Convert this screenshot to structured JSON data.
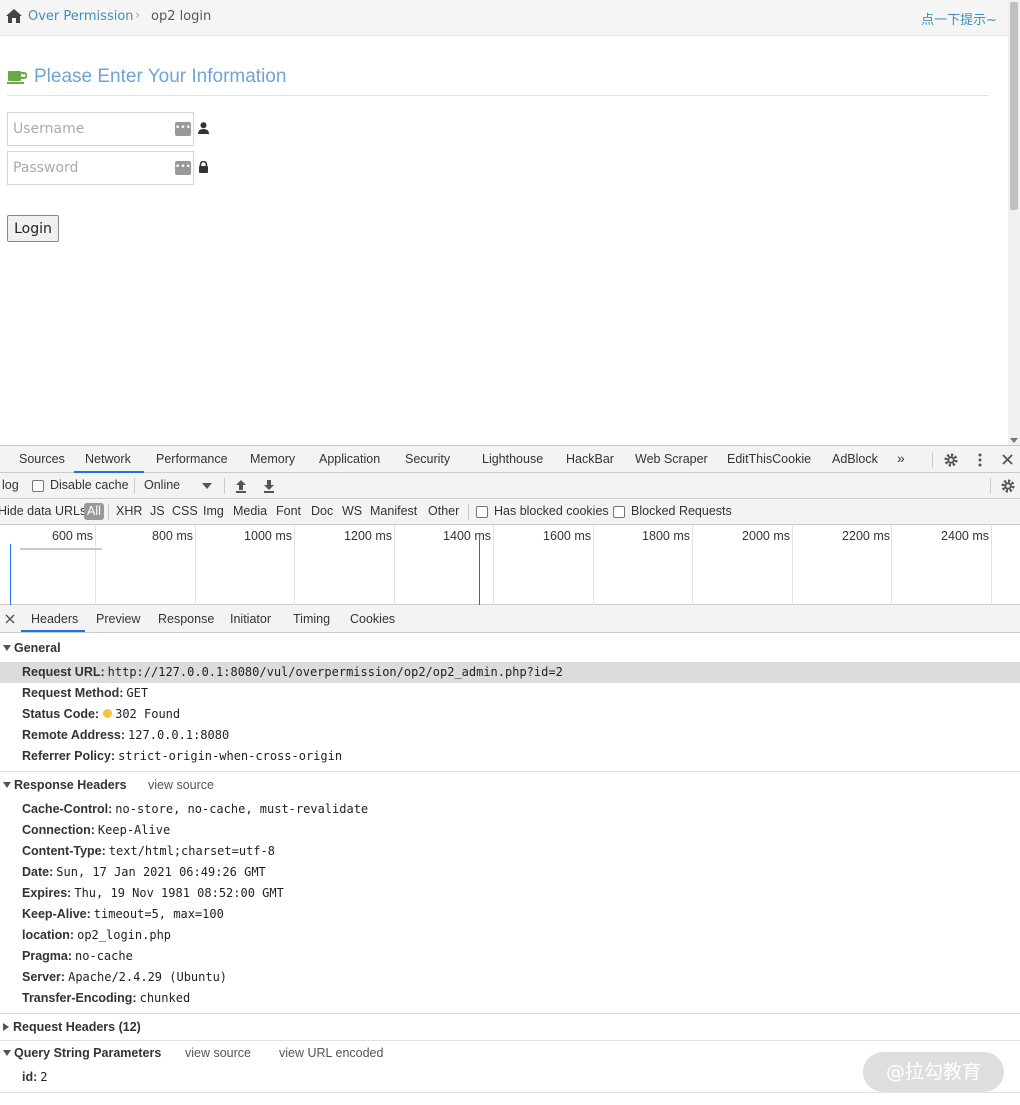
{
  "breadcrumb": {
    "home_icon": "home-icon",
    "parent": "Over Permission",
    "separator": "›",
    "current": "op2 login",
    "hint": "点一下提示~"
  },
  "header": {
    "icon": "coffee-cup-icon",
    "title": "Please Enter Your Information"
  },
  "form": {
    "username_placeholder": "Username",
    "password_placeholder": "Password",
    "login_label": "Login",
    "username_icon": "user-icon",
    "password_icon": "lock-icon"
  },
  "devtools": {
    "tabs": [
      "Sources",
      "Network",
      "Performance",
      "Memory",
      "Application",
      "Security",
      "Lighthouse",
      "HackBar",
      "Web Scraper",
      "EditThisCookie",
      "AdBlock",
      "»"
    ],
    "active_tab": "Network",
    "toolbar1": {
      "preserve_log": "log",
      "disable_cache": "Disable cache",
      "throttle": "Online"
    },
    "toolbar2": {
      "hide_data_urls": "Hide data URLs",
      "filters": [
        "All",
        "XHR",
        "JS",
        "CSS",
        "Img",
        "Media",
        "Font",
        "Doc",
        "WS",
        "Manifest",
        "Other"
      ],
      "has_blocked_cookies": "Has blocked cookies",
      "blocked_requests": "Blocked Requests"
    },
    "timeline_ticks": [
      "600 ms",
      "800 ms",
      "1000 ms",
      "1200 ms",
      "1400 ms",
      "1600 ms",
      "1800 ms",
      "2000 ms",
      "2200 ms",
      "2400 ms"
    ],
    "detail_tabs": [
      "Headers",
      "Preview",
      "Response",
      "Initiator",
      "Timing",
      "Cookies"
    ],
    "active_detail_tab": "Headers",
    "general": {
      "title": "General",
      "rows": [
        {
          "k": "Request URL:",
          "v": "http://127.0.0.1:8080/vul/overpermission/op2/op2_admin.php?id=2"
        },
        {
          "k": "Request Method:",
          "v": "GET"
        },
        {
          "k": "Status Code:",
          "v": "302 Found"
        },
        {
          "k": "Remote Address:",
          "v": "127.0.0.1:8080"
        },
        {
          "k": "Referrer Policy:",
          "v": "strict-origin-when-cross-origin"
        }
      ]
    },
    "response_headers": {
      "title": "Response Headers",
      "view_source": "view source",
      "rows": [
        {
          "k": "Cache-Control:",
          "v": "no-store, no-cache, must-revalidate"
        },
        {
          "k": "Connection:",
          "v": "Keep-Alive"
        },
        {
          "k": "Content-Type:",
          "v": "text/html;charset=utf-8"
        },
        {
          "k": "Date:",
          "v": "Sun, 17 Jan 2021 06:49:26 GMT"
        },
        {
          "k": "Expires:",
          "v": "Thu, 19 Nov 1981 08:52:00 GMT"
        },
        {
          "k": "Keep-Alive:",
          "v": "timeout=5, max=100"
        },
        {
          "k": "location:",
          "v": "op2_login.php"
        },
        {
          "k": "Pragma:",
          "v": "no-cache"
        },
        {
          "k": "Server:",
          "v": "Apache/2.4.29 (Ubuntu)"
        },
        {
          "k": "Transfer-Encoding:",
          "v": "chunked"
        }
      ]
    },
    "request_headers": {
      "title": "Request Headers (12)"
    },
    "query_string": {
      "title": "Query String Parameters",
      "view_source": "view source",
      "view_url_encoded": "view URL encoded",
      "rows": [
        {
          "k": "id:",
          "v": "2"
        }
      ]
    }
  },
  "watermark": "@拉勾教育",
  "colors": {
    "link": "#438eb9",
    "header_title": "#6fa3d6",
    "devtools_accent": "#1a73e8",
    "status_dot": "#f4c542"
  }
}
